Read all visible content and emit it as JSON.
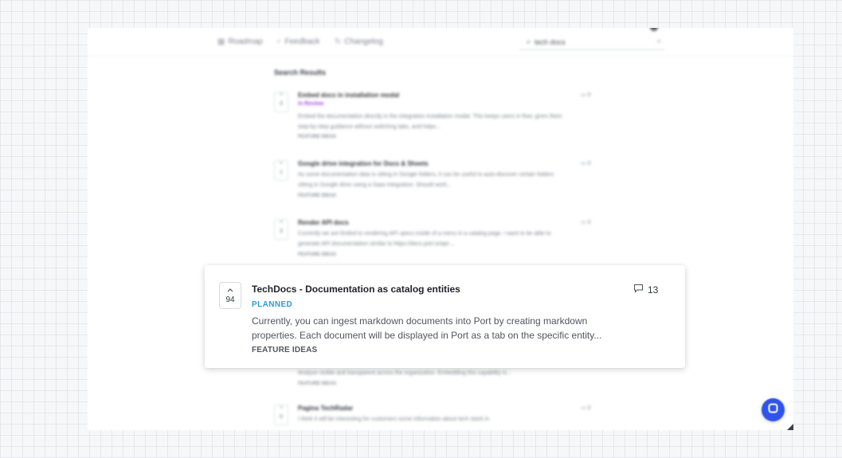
{
  "nav": {
    "roadmap": "Roadmap",
    "feedback": "Feedback",
    "changelog": "Changelog",
    "search_value": "tech docs"
  },
  "results_heading": "Search Results",
  "posts": [
    {
      "votes": "3",
      "title": "Embed docs in installation modal",
      "status": "In Review",
      "body": "Embed the documentation directly in the integration installation modal. This keeps users in flow, gives them step-by-step guidance without switching tabs, and helps...",
      "tag": "FEATURE IDEAS",
      "comments": "0"
    },
    {
      "votes": "1",
      "title": "Google drive integration for Docs & Sheets",
      "body": "As some documentation data is sitting in Google folders, it can be useful to auto-discover certain folders sitting in Google drive using a Saas integration. Should work...",
      "tag": "FEATURE IDEAS",
      "comments": "0"
    },
    {
      "votes": "3",
      "title": "Render API docs",
      "body": "Currently we are limited to rendering API specs inside of a menu in a catalog page. I want to be able to generate API documentation similar to https://docs.port.io/api-...",
      "tag": "FEATURE IDEAS",
      "comments": "0"
    },
    {
      "body": "Analyze visible and transparent across the organization. Embedding this capability is...",
      "tag": "FEATURE IDEAS"
    },
    {
      "votes": "0",
      "title": "Pagina TechRadar",
      "body": "I think it will be interesting for customers some information about tech stack in",
      "comments": "0"
    }
  ],
  "highlight": {
    "votes": "94",
    "title": "TechDocs - Documentation as catalog entities",
    "status": "PLANNED",
    "body": "Currently, you can ingest markdown documents into Port by creating markdown properties. Each document will be displayed in Port as a tab on the specific entity...",
    "tag": "FEATURE IDEAS",
    "comments": "13"
  },
  "colors": {
    "status_planned": "#2b9bd8",
    "status_review": "#a347e0",
    "chat_button": "#2f54eb"
  }
}
